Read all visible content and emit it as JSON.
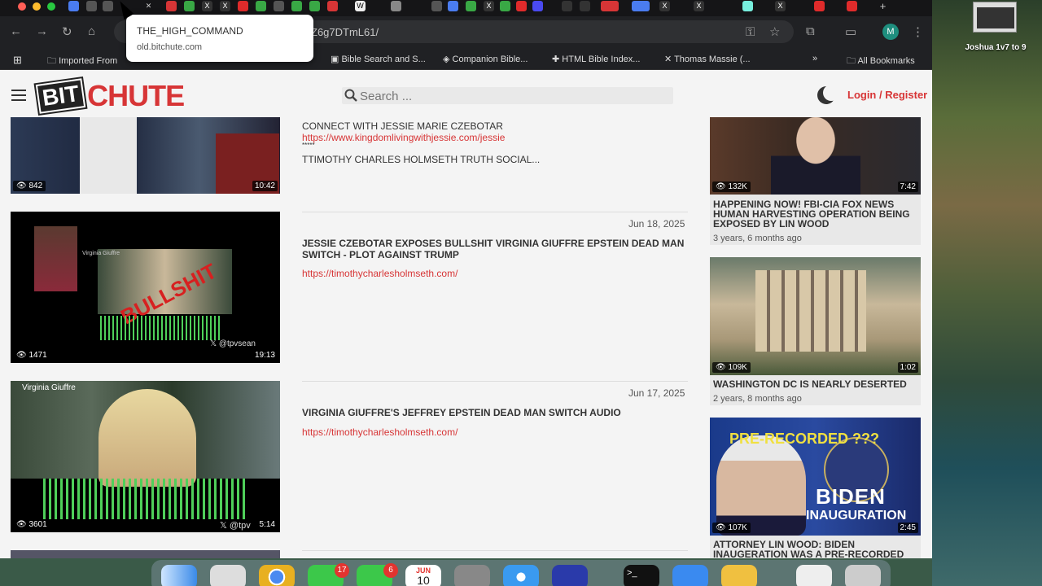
{
  "desktop": {
    "file_label": "Joshua 1v7 to 9"
  },
  "browser": {
    "url_suffix": "Z6g7DTmL61/",
    "tooltip": {
      "title": "THE_HIGH_COMMAND",
      "domain": "old.bitchute.com"
    },
    "profile_initial": "M",
    "bookmarks": [
      "Imported From",
      "Bible Search and S...",
      "Companion Bible...",
      "HTML Bible Index...",
      "Thomas Massie (...",
      "»",
      "All Bookmarks"
    ]
  },
  "site": {
    "logo_bit": "BIT",
    "logo_chute": "CHUTE",
    "search_placeholder": "Search ...",
    "login_label": "Login / Register"
  },
  "feed": {
    "top": {
      "views": "842",
      "duration": "10:42",
      "desc_line1": "CONNECT WITH JESSIE MARIE CZEBOTAR",
      "desc_link": "https://www.kingdomlivingwithjessie.com/jessie",
      "desc_stars": "*****",
      "desc_line2": "TTIMOTHY CHARLES HOLMSETH TRUTH SOCIAL..."
    },
    "items": [
      {
        "date": "Jun 18, 2025",
        "title": "JESSIE CZEBOTAR EXPOSES BULLSHIT VIRGINIA GIUFFRE EPSTEIN DEAD MAN SWITCH - PLOT AGAINST TRUMP",
        "link": "https://timothycharlesholmseth.com/",
        "views": "1471",
        "duration": "19:13",
        "thumb_name": "Virginia Giuffre",
        "thumb_overlay": "BULLSHIT",
        "thumb_handle": "@tpvsean"
      },
      {
        "date": "Jun 17, 2025",
        "title": "VIRGINIA GIUFFRE'S JEFFREY EPSTEIN DEAD MAN SWITCH AUDIO",
        "link": "https://timothycharlesholmseth.com/",
        "views": "3601",
        "duration": "5:14",
        "thumb_name": "Virginia Giuffre",
        "thumb_handle": "@tpv"
      }
    ]
  },
  "sidebar": [
    {
      "views": "132K",
      "duration": "7:42",
      "title": "HAPPENING NOW! FBI-CIA FOX NEWS HUMAN HARVESTING OPERATION BEING EXPOSED BY LIN WOOD",
      "age": "3 years, 6 months ago"
    },
    {
      "views": "109K",
      "duration": "1:02",
      "title": "WASHINGTON DC IS NEARLY DESERTED",
      "age": "2 years, 8 months ago"
    },
    {
      "views": "107K",
      "duration": "2:45",
      "title": "ATTORNEY LIN WOOD: BIDEN INAUGERATION WAS A PRE-RECORDED",
      "thumb_top": "PRE-RECORDED ???",
      "thumb_big": "BIDEN",
      "thumb_sub": "INAUGURATION"
    }
  ],
  "dock": {
    "badge_messages": "17",
    "badge_facetime": "6",
    "calendar_month": "JUN",
    "calendar_day": "10"
  },
  "colors": {
    "brand_red": "#d73536",
    "text_dark": "#333333"
  }
}
